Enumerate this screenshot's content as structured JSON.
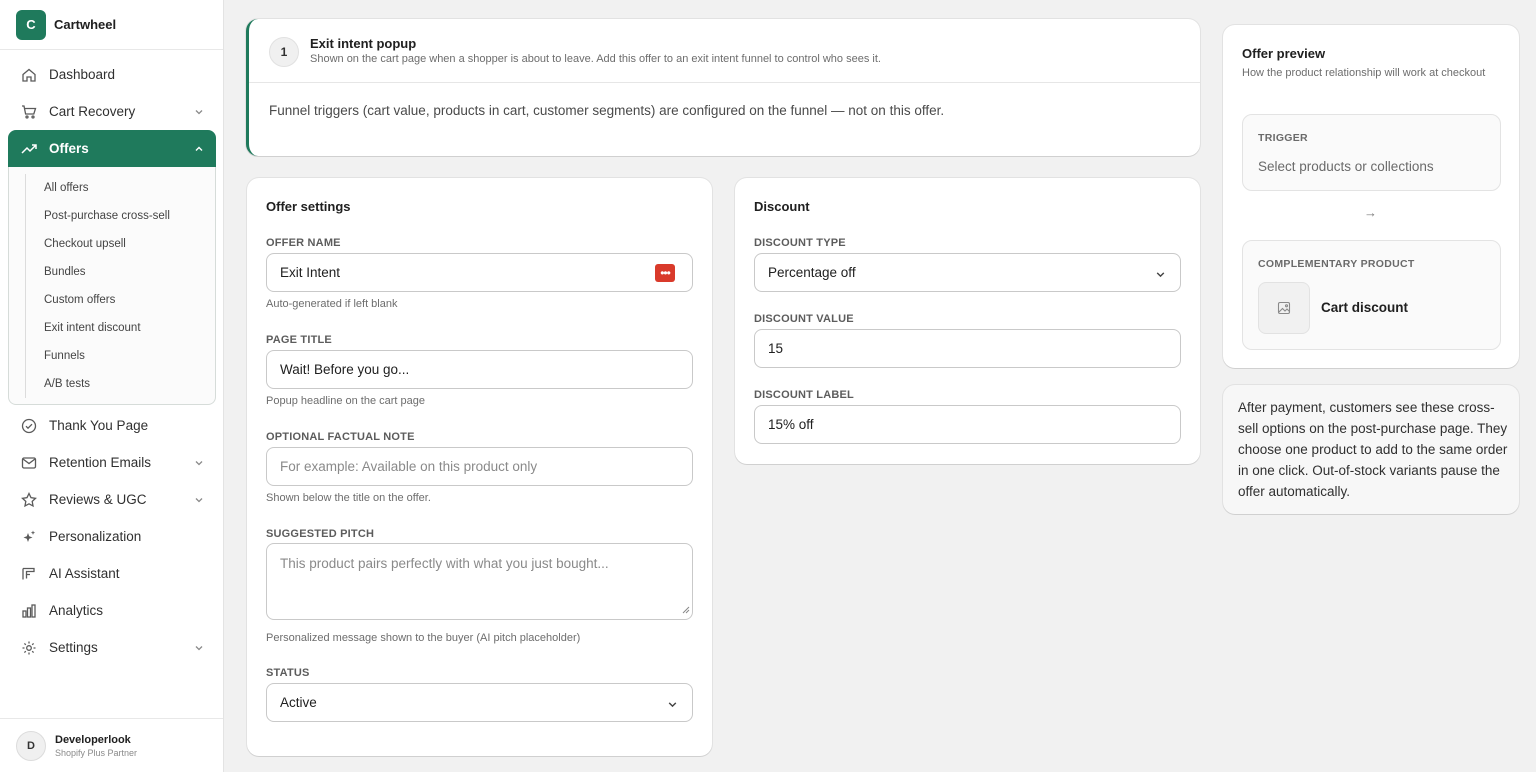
{
  "brand": {
    "initial": "C",
    "name": "Cartwheel",
    "color": "#1f7a5c"
  },
  "sidebar": {
    "items": [
      {
        "label": "Dashboard",
        "icon": "home-icon"
      },
      {
        "label": "Cart Recovery",
        "icon": "cart-icon",
        "chevron": "down"
      },
      {
        "label": "Offers",
        "icon": "trending-up-icon",
        "chevron": "up",
        "active": true
      },
      {
        "label": "Thank You Page",
        "icon": "check-circle-icon"
      },
      {
        "label": "Retention Emails",
        "icon": "mail-icon",
        "chevron": "down"
      },
      {
        "label": "Reviews & UGC",
        "icon": "star-icon",
        "chevron": "down"
      },
      {
        "label": "Personalization",
        "icon": "sparkle-icon"
      },
      {
        "label": "AI Assistant",
        "icon": "ai-assistant-icon"
      },
      {
        "label": "Analytics",
        "icon": "bar-chart-icon"
      },
      {
        "label": "Settings",
        "icon": "gear-icon",
        "chevron": "down"
      }
    ],
    "offers_sub": [
      "All offers",
      "Post-purchase cross-sell",
      "Checkout upsell",
      "Bundles",
      "Custom offers",
      "Exit intent discount",
      "Funnels",
      "A/B tests"
    ]
  },
  "account": {
    "initial": "D",
    "name": "Developerlook",
    "role": "Shopify Plus Partner"
  },
  "popup": {
    "step": "1",
    "title": "Exit intent popup",
    "subtitle": "Shown on the cart page when a shopper is about to leave. Add this offer to an exit intent funnel to control who sees it.",
    "note": "Funnel triggers (cart value, products in cart, customer segments) are configured on the funnel — not on this offer."
  },
  "offer_settings": {
    "title": "Offer settings",
    "offer_name_label": "OFFER NAME",
    "offer_name_value": "Exit Intent",
    "offer_name_help": "Auto-generated if left blank",
    "page_title_label": "PAGE TITLE",
    "page_title_value": "Wait! Before you go...",
    "page_title_help": "Popup headline on the cart page",
    "factual_note_label": "OPTIONAL FACTUAL NOTE",
    "factual_note_placeholder": "For example: Available on this product only",
    "factual_note_help": "Shown below the title on the offer.",
    "pitch_label": "SUGGESTED PITCH",
    "pitch_placeholder": "This product pairs perfectly with what you just bought...",
    "pitch_help": "Personalized message shown to the buyer (AI pitch placeholder)",
    "status_label": "STATUS",
    "status_value": "Active"
  },
  "discount": {
    "title": "Discount",
    "type_label": "DISCOUNT TYPE",
    "type_value": "Percentage off",
    "value_label": "DISCOUNT VALUE",
    "value_value": "15",
    "label_label": "DISCOUNT LABEL",
    "label_value": "15% off"
  },
  "preview": {
    "title": "Offer preview",
    "subtitle": "How the product relationship will work at checkout",
    "trigger_label": "TRIGGER",
    "trigger_value": "Select products or collections",
    "arrow": "→",
    "comp_label": "COMPLEMENTARY PRODUCT",
    "comp_value": "Cart discount"
  },
  "info_text": "After payment, customers see these cross-sell options on the post-purchase page. They choose one product to add to the same order in one click. Out-of-stock variants pause the offer automatically."
}
